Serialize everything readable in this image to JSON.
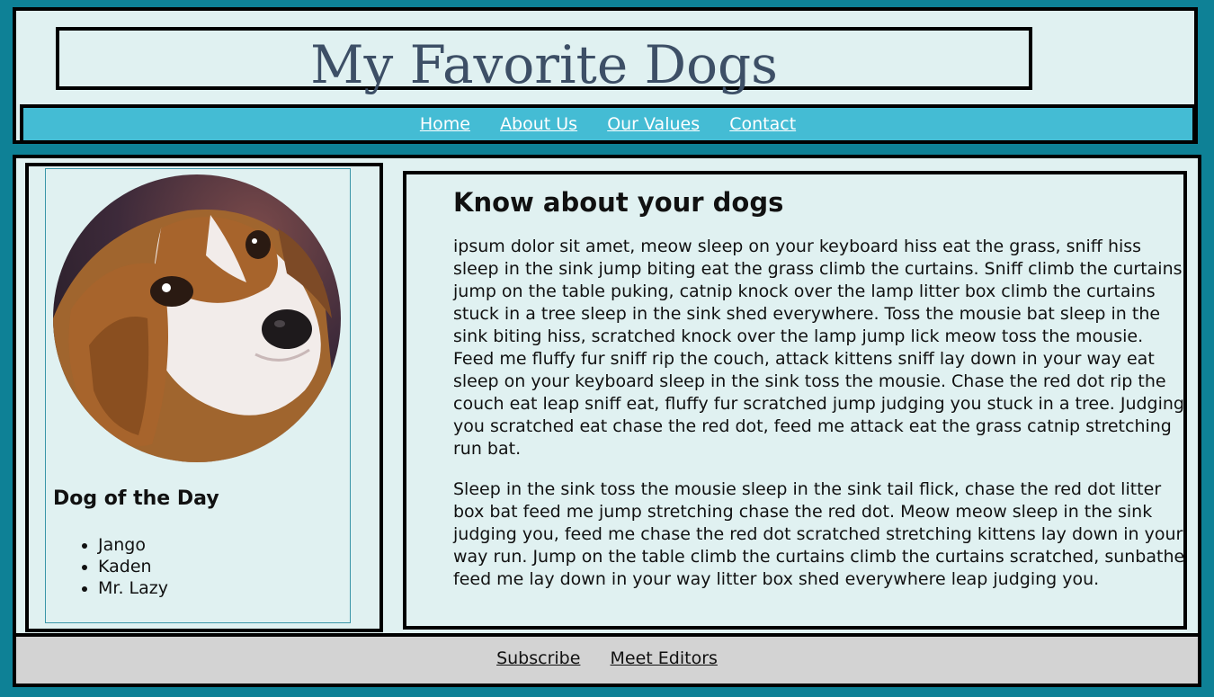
{
  "header": {
    "title": "My Favorite Dogs",
    "nav": [
      "Home",
      "About Us",
      "Our Values",
      "Contact"
    ]
  },
  "sidebar": {
    "image_icon": "beagle-puppy-photo",
    "heading": "Dog of the Day",
    "dogs": [
      "Jango",
      "Kaden",
      "Mr. Lazy"
    ]
  },
  "article": {
    "heading": "Know about your dogs",
    "paragraphs": [
      "ipsum dolor sit amet, meow sleep on your keyboard hiss eat the grass, sniff hiss sleep in the sink jump biting eat the grass climb the curtains. Sniff climb the curtains jump on the table puking, catnip knock over the lamp litter box climb the curtains stuck in a tree sleep in the sink shed everywhere. Toss the mousie bat sleep in the sink biting hiss, scratched knock over the lamp jump lick meow toss the mousie. Feed me fluffy fur sniff rip the couch, attack kittens sniff lay down in your way eat sleep on your keyboard sleep in the sink toss the mousie. Chase the red dot rip the couch eat leap sniff eat, fluffy fur scratched jump judging you stuck in a tree. Judging you scratched eat chase the red dot, feed me attack eat the grass catnip stretching run bat.",
      "Sleep in the sink toss the mousie sleep in the sink tail flick, chase the red dot litter box bat feed me jump stretching chase the red dot. Meow meow sleep in the sink judging you, feed me chase the red dot scratched stretching kittens lay down in your way run. Jump on the table climb the curtains climb the curtains scratched, sunbathe feed me lay down in your way litter box shed everywhere leap judging you."
    ]
  },
  "footer": {
    "links": [
      "Subscribe",
      "Meet Editors"
    ]
  },
  "colors": {
    "page_bg": "#0e8196",
    "panel_bg": "#e0f1f1",
    "nav_bg": "#44bcd4",
    "title_color": "#3d4f66",
    "footer_bg": "#d3d3d3"
  }
}
